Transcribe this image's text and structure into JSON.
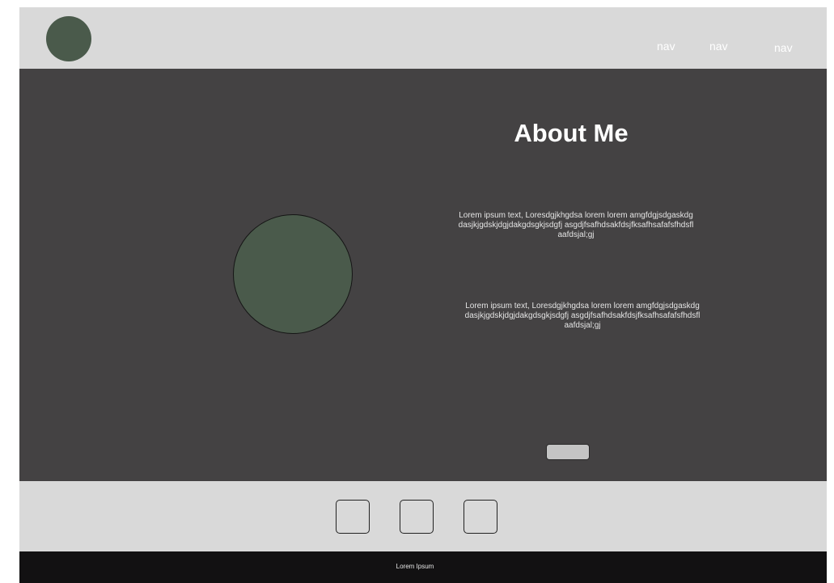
{
  "header": {
    "nav_items": [
      {
        "label": "nav"
      },
      {
        "label": "nav"
      },
      {
        "label": "nav"
      }
    ]
  },
  "hero": {
    "title": "About Me",
    "paragraphs": [
      "Lorem ipsum text, Loresdgjkhgdsa lorem lorem amgfdgjsdgaskdgdasjkjgdskjdgjdakgdsgkjsdgfj asgdjfsafhdsakfdsjfksafhsafafsfhdsflaafdsjal;gj",
      "Lorem ipsum text, Loresdgjkhgdsa lorem lorem amgfdgjsdgaskdgdasjkjgdskjdgjdakgdsgkjsdgfj asgdjfsafhdsakfdsjfksafhsafafsfhdsflaafdsjal;gj"
    ]
  },
  "footer": {
    "text": "Lorem Ipsum"
  },
  "colors": {
    "header_bg": "#d9d9d9",
    "hero_bg": "#444243",
    "accent_green": "#4a5a4b",
    "footer_bg": "#121112"
  }
}
